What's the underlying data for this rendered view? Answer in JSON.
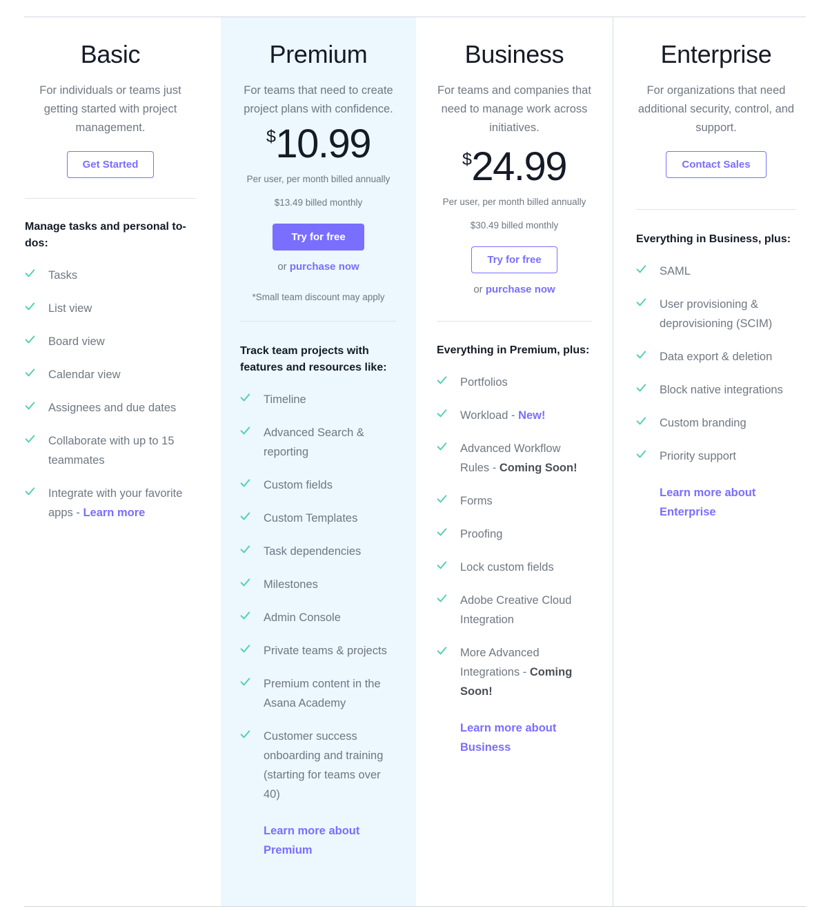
{
  "theme": {
    "accent_purple": "#796EFF",
    "check_green": "#4ECFB0",
    "premium_bg": "#ECF7FE",
    "text_dark": "#151B26",
    "text_muted": "#6F7782",
    "rule": "#CFD6DD"
  },
  "plans": [
    {
      "id": "basic",
      "name": "Basic",
      "description": "For individuals or teams just getting started with project management.",
      "price": null,
      "currency_symbol": null,
      "price_note": null,
      "price_sub": null,
      "cta_label": "Get Started",
      "cta_style": "outline",
      "or_prefix": null,
      "or_link": null,
      "disclaimer": null,
      "features_title": "Manage tasks and personal to-dos:",
      "features": [
        {
          "text": "Tasks"
        },
        {
          "text": "List view"
        },
        {
          "text": "Board view"
        },
        {
          "text": "Calendar view"
        },
        {
          "text": "Assignees and due dates"
        },
        {
          "text": "Collaborate with up to 15 teammates"
        },
        {
          "text": "Integrate with your favorite apps - ",
          "link": "Learn more"
        }
      ],
      "learn_more": null
    },
    {
      "id": "premium",
      "name": "Premium",
      "description": "For teams that need to create project plans with confidence.",
      "currency_symbol": "$",
      "price": "10.99",
      "price_note": "Per user, per month billed annually",
      "price_sub": "$13.49 billed monthly",
      "cta_label": "Try for free",
      "cta_style": "solid",
      "or_prefix": "or ",
      "or_link": "purchase now",
      "disclaimer": "*Small team discount may apply",
      "features_title": "Track team projects with features and resources like:",
      "features": [
        {
          "text": "Timeline"
        },
        {
          "text": "Advanced Search & reporting"
        },
        {
          "text": "Custom fields"
        },
        {
          "text": "Custom Templates"
        },
        {
          "text": "Task dependencies"
        },
        {
          "text": "Milestones"
        },
        {
          "text": "Admin Console"
        },
        {
          "text": "Private teams & projects"
        },
        {
          "text": "Premium content in the Asana Academy"
        },
        {
          "text": "Customer success onboarding and training (starting for teams over 40)"
        }
      ],
      "learn_more": "Learn more about Premium"
    },
    {
      "id": "business",
      "name": "Business",
      "description": "For teams and companies that need to manage work across initiatives.",
      "currency_symbol": "$",
      "price": "24.99",
      "price_note": "Per user, per month billed annually",
      "price_sub": "$30.49 billed monthly",
      "cta_label": "Try for free",
      "cta_style": "outline",
      "or_prefix": "or ",
      "or_link": "purchase now",
      "disclaimer": null,
      "features_title": "Everything in Premium, plus:",
      "features": [
        {
          "text": "Portfolios"
        },
        {
          "text": "Workload - ",
          "link": "New!"
        },
        {
          "text": "Advanced Workflow Rules - ",
          "bold": "Coming Soon!"
        },
        {
          "text": "Forms"
        },
        {
          "text": "Proofing"
        },
        {
          "text": "Lock custom fields"
        },
        {
          "text": "Adobe Creative Cloud Integration"
        },
        {
          "text": "More Advanced Integrations - ",
          "bold": "Coming Soon!"
        }
      ],
      "learn_more": "Learn more about Business"
    },
    {
      "id": "enterprise",
      "name": "Enterprise",
      "description": "For organizations that need additional security, control, and support.",
      "price": null,
      "currency_symbol": null,
      "price_note": null,
      "price_sub": null,
      "cta_label": "Contact Sales",
      "cta_style": "outline",
      "or_prefix": null,
      "or_link": null,
      "disclaimer": null,
      "features_title": "Everything in Business, plus:",
      "features": [
        {
          "text": "SAML"
        },
        {
          "text": "User provisioning & deprovisioning (SCIM)"
        },
        {
          "text": "Data export & deletion"
        },
        {
          "text": "Block native integrations"
        },
        {
          "text": "Custom branding"
        },
        {
          "text": "Priority support"
        }
      ],
      "learn_more": "Learn more about Enterprise"
    }
  ]
}
